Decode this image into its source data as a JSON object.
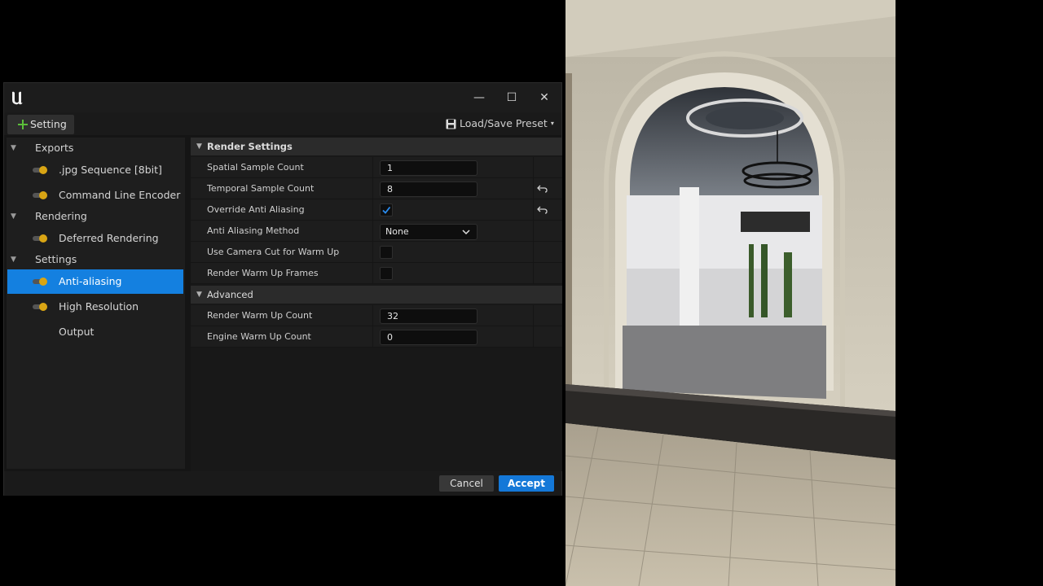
{
  "window": {
    "minimize_glyph": "—",
    "maximize_glyph": "☐",
    "close_glyph": "✕"
  },
  "toolbar": {
    "setting_label": "Setting",
    "preset_label": "Load/Save Preset",
    "preset_caret": "▾"
  },
  "sidebar": {
    "groups": [
      {
        "label": "Exports",
        "items": [
          ".jpg Sequence [8bit]",
          "Command Line Encoder"
        ]
      },
      {
        "label": "Rendering",
        "items": [
          "Deferred Rendering"
        ]
      },
      {
        "label": "Settings",
        "items": [
          "Anti-aliasing",
          "High Resolution",
          "Output"
        ]
      }
    ],
    "selected_item": "Anti-aliasing"
  },
  "panel": {
    "render_settings_title": "Render Settings",
    "rows": [
      {
        "label": "Spatial Sample Count",
        "value": "1"
      },
      {
        "label": "Temporal Sample Count",
        "value": "8"
      },
      {
        "label": "Override Anti Aliasing",
        "checked": true
      },
      {
        "label": "Anti Aliasing Method",
        "value": "None"
      },
      {
        "label": "Use Camera Cut for Warm Up",
        "checked": false
      },
      {
        "label": "Render Warm Up Frames",
        "checked": false
      }
    ],
    "advanced_title": "Advanced",
    "advanced_rows": [
      {
        "label": "Render Warm Up Count",
        "value": "32"
      },
      {
        "label": "Engine Warm Up Count",
        "value": "0"
      }
    ]
  },
  "footer": {
    "cancel_label": "Cancel",
    "accept_label": "Accept"
  },
  "colors": {
    "accent": "#1480e0",
    "toggle_knob": "#d9a514",
    "plus_icon": "#5bbf3a"
  }
}
